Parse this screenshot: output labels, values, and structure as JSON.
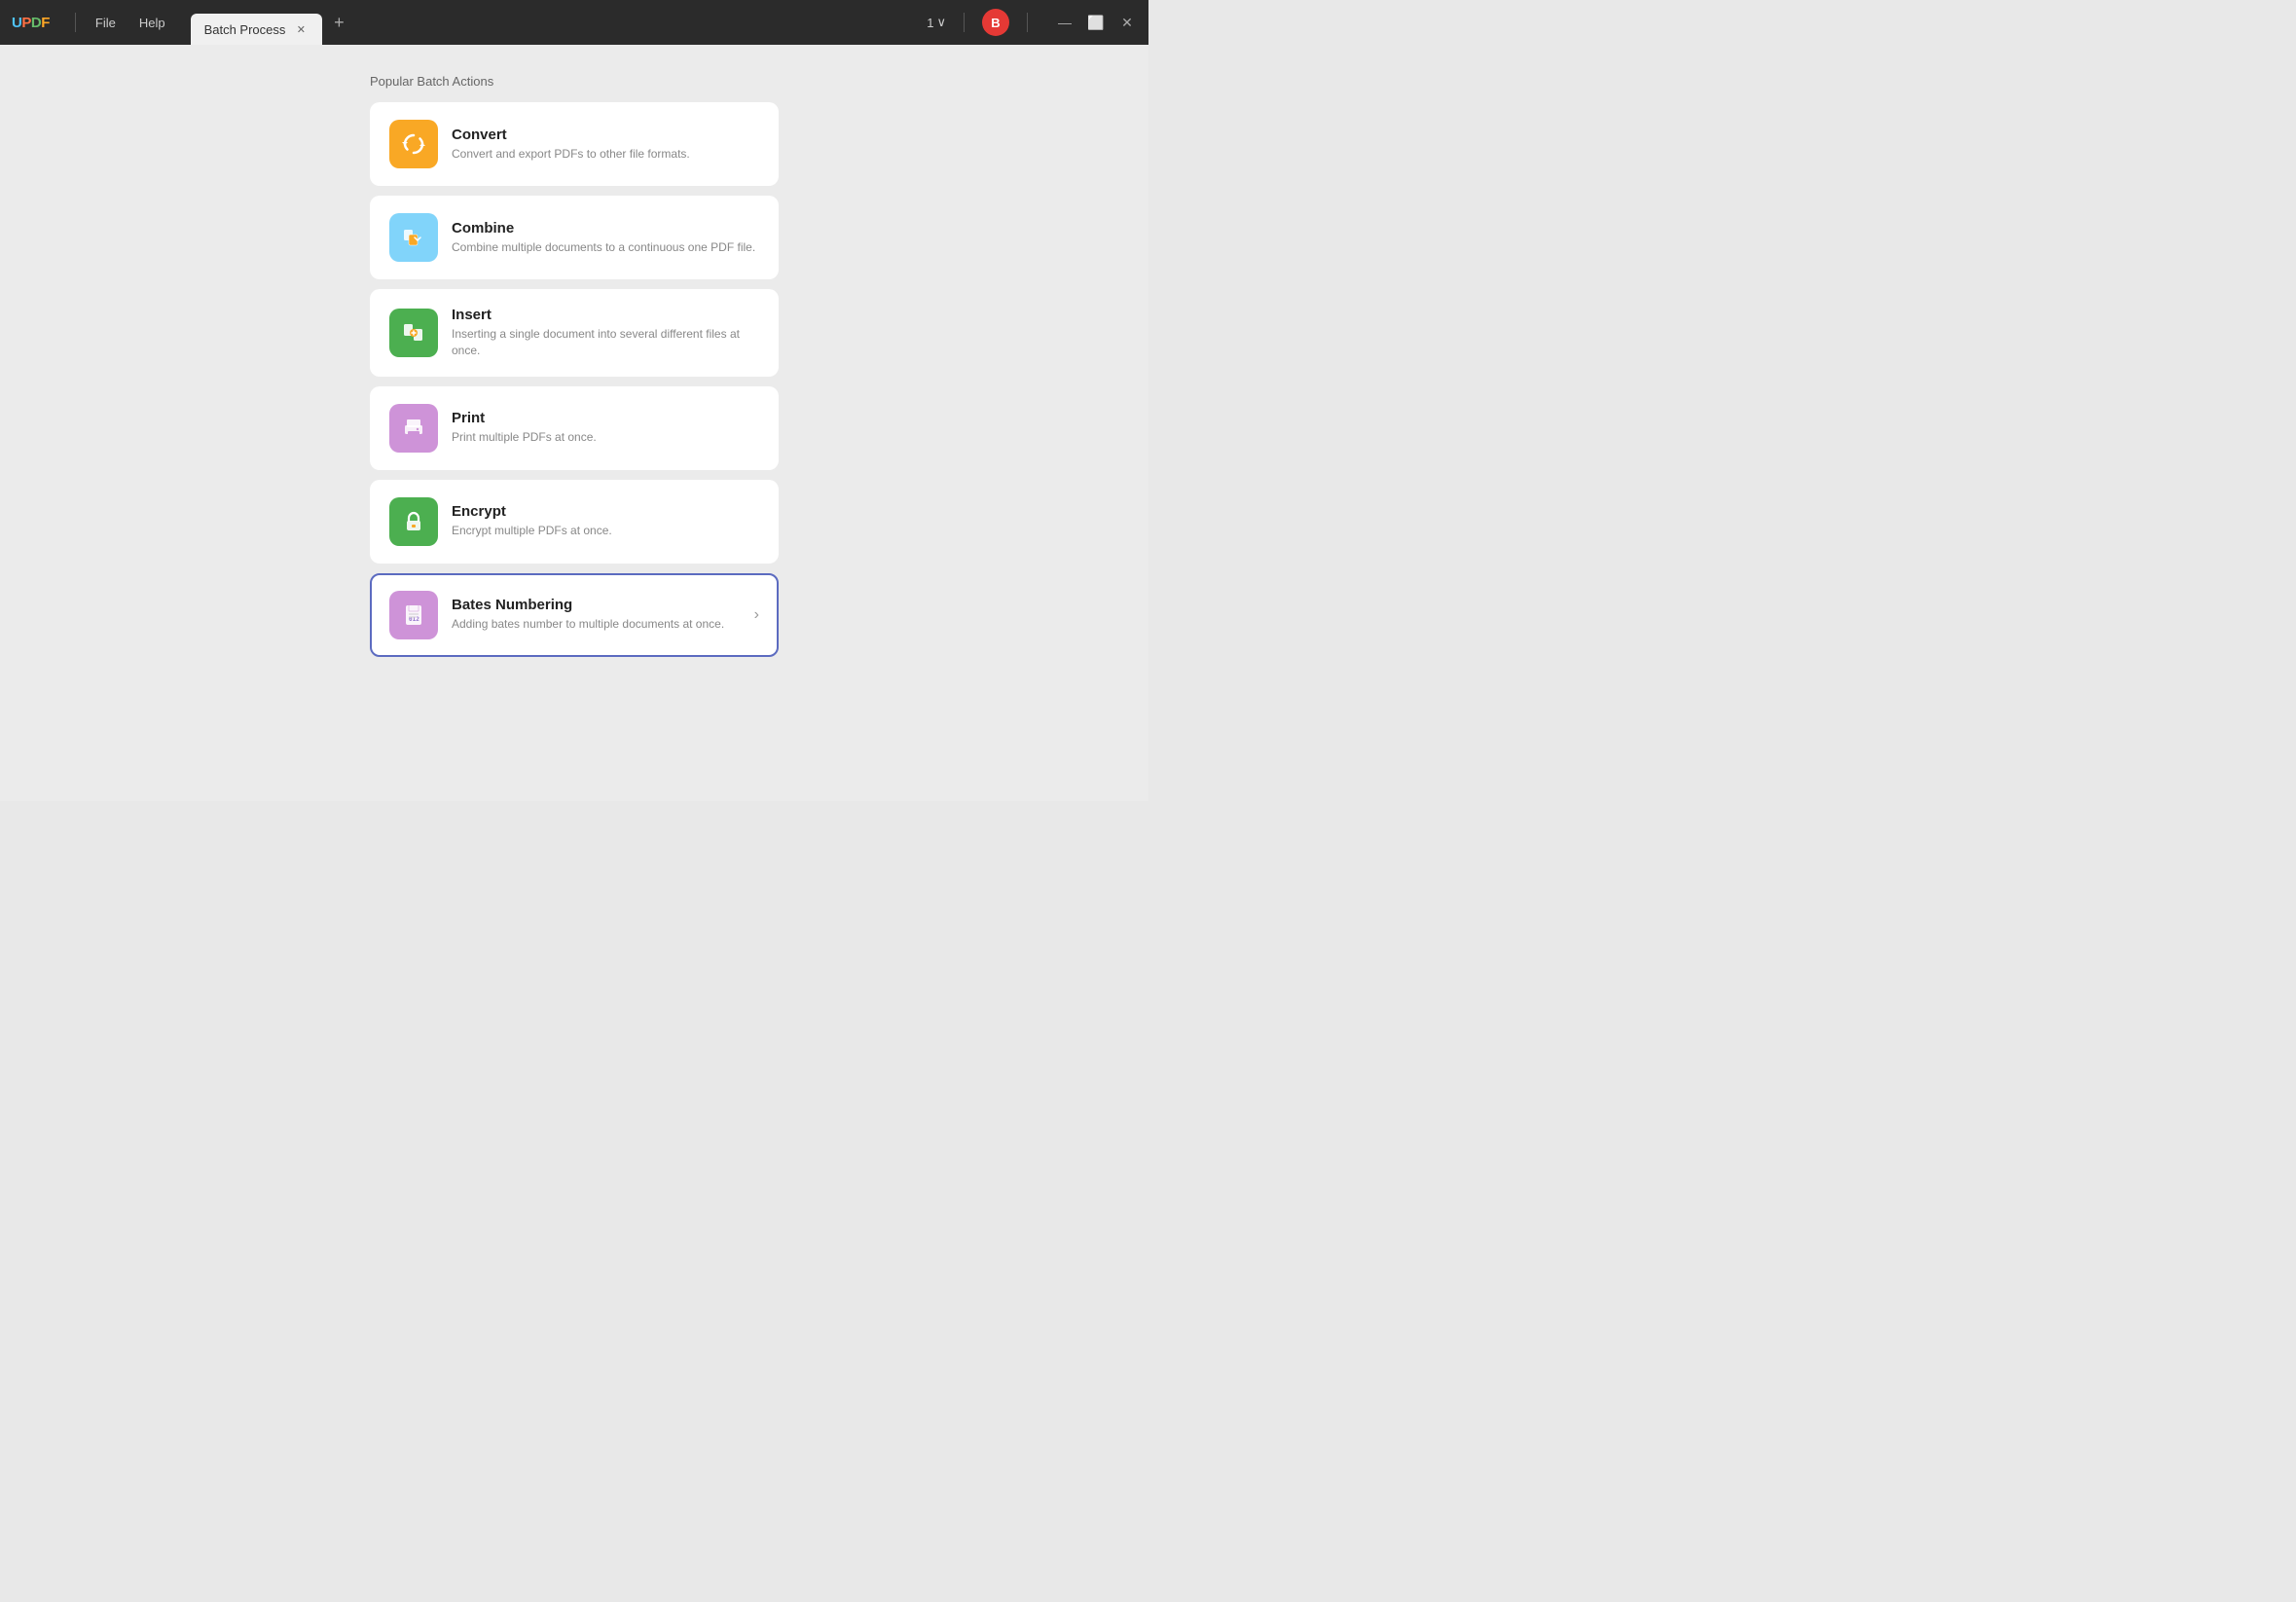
{
  "titlebar": {
    "logo": {
      "u": "U",
      "p": "P",
      "d": "D",
      "f": "F"
    },
    "menu": [
      {
        "label": "File"
      },
      {
        "label": "Help"
      }
    ],
    "tab": {
      "label": "Batch Process"
    },
    "tab_count": "1",
    "avatar_label": "B",
    "window_controls": {
      "minimize": "—",
      "maximize": "⬜",
      "close": "✕"
    }
  },
  "main": {
    "section_title": "Popular Batch Actions",
    "actions": [
      {
        "id": "convert",
        "title": "Convert",
        "desc": "Convert and export PDFs to other file formats.",
        "icon_type": "convert",
        "selected": false,
        "has_chevron": false
      },
      {
        "id": "combine",
        "title": "Combine",
        "desc": "Combine multiple documents to a continuous one PDF file.",
        "icon_type": "combine",
        "selected": false,
        "has_chevron": false
      },
      {
        "id": "insert",
        "title": "Insert",
        "desc": "Inserting a single document into several different files at once.",
        "icon_type": "insert",
        "selected": false,
        "has_chevron": false
      },
      {
        "id": "print",
        "title": "Print",
        "desc": "Print multiple PDFs at once.",
        "icon_type": "print",
        "selected": false,
        "has_chevron": false
      },
      {
        "id": "encrypt",
        "title": "Encrypt",
        "desc": "Encrypt multiple PDFs at once.",
        "icon_type": "encrypt",
        "selected": false,
        "has_chevron": false
      },
      {
        "id": "bates",
        "title": "Bates Numbering",
        "desc": "Adding bates number to multiple documents at once.",
        "icon_type": "bates",
        "selected": true,
        "has_chevron": true
      }
    ]
  }
}
